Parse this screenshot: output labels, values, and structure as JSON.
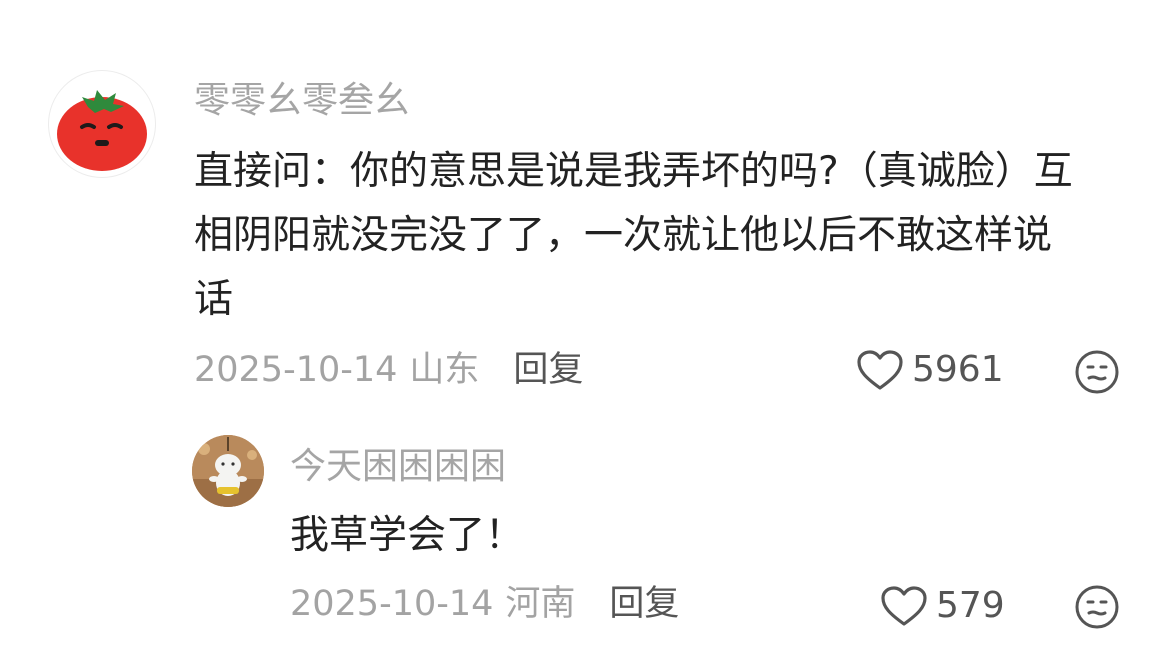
{
  "comments": [
    {
      "username": "零零幺零叁幺",
      "text_lines": [
        "直接问：你的意思是说是我弄坏的吗?（真诚脸）互",
        "相阴阳就没完没了了，一次就让他以后不敢这样说",
        "话"
      ],
      "date": "2025-10-14",
      "location": "山东",
      "reply_label": "回复",
      "likes": "5961",
      "icons": {
        "like": "heart-outline-icon",
        "reaction": "neutral-face-icon"
      },
      "avatar": "tomato-face-avatar",
      "colors": {
        "tomato": "#e8322b",
        "leaf": "#2f8a3c"
      }
    },
    {
      "username": "今天困困困困",
      "text": "我草学会了！",
      "date": "2025-10-14",
      "location": "河南",
      "reply_label": "回复",
      "likes": "579",
      "icons": {
        "like": "heart-outline-icon",
        "reaction": "neutral-face-icon"
      },
      "avatar": "plush-toy-avatar"
    }
  ],
  "colors": {
    "username": "#a5a5a5",
    "text": "#222222",
    "meta": "#a3a3a3",
    "action": "#555555"
  }
}
